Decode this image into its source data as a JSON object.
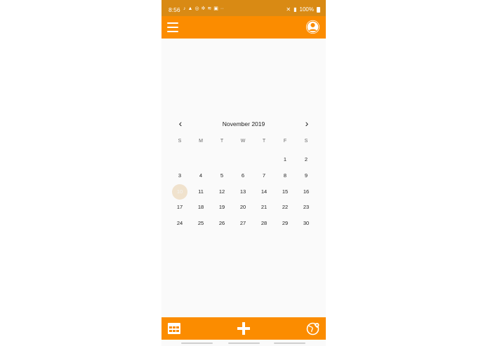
{
  "status_bar": {
    "time": "8:56",
    "left_icons": [
      "tiktok-icon",
      "snapchat-icon",
      "instagram-icon",
      "app-icon",
      "wifi-icon",
      "image-icon",
      "dots-icon"
    ],
    "battery": "100%"
  },
  "calendar": {
    "month_title": "November 2019",
    "prev_label": "‹",
    "next_label": "›",
    "weekdays": [
      "S",
      "M",
      "T",
      "W",
      "T",
      "F",
      "S"
    ],
    "leading_blanks": 5,
    "days": [
      "1",
      "2",
      "3",
      "4",
      "5",
      "6",
      "7",
      "8",
      "9",
      "10",
      "11",
      "12",
      "13",
      "14",
      "15",
      "16",
      "17",
      "18",
      "19",
      "20",
      "21",
      "22",
      "23",
      "24",
      "25",
      "26",
      "27",
      "28",
      "29",
      "30"
    ],
    "selected_day": "10"
  },
  "colors": {
    "app_bar": "#fb8c00",
    "status_bar": "#d98a14",
    "today_highlight": "#f0e2cd"
  },
  "bottom_bar": {
    "icons": [
      "calendar-grid-icon",
      "add-icon",
      "globe-icon"
    ]
  }
}
